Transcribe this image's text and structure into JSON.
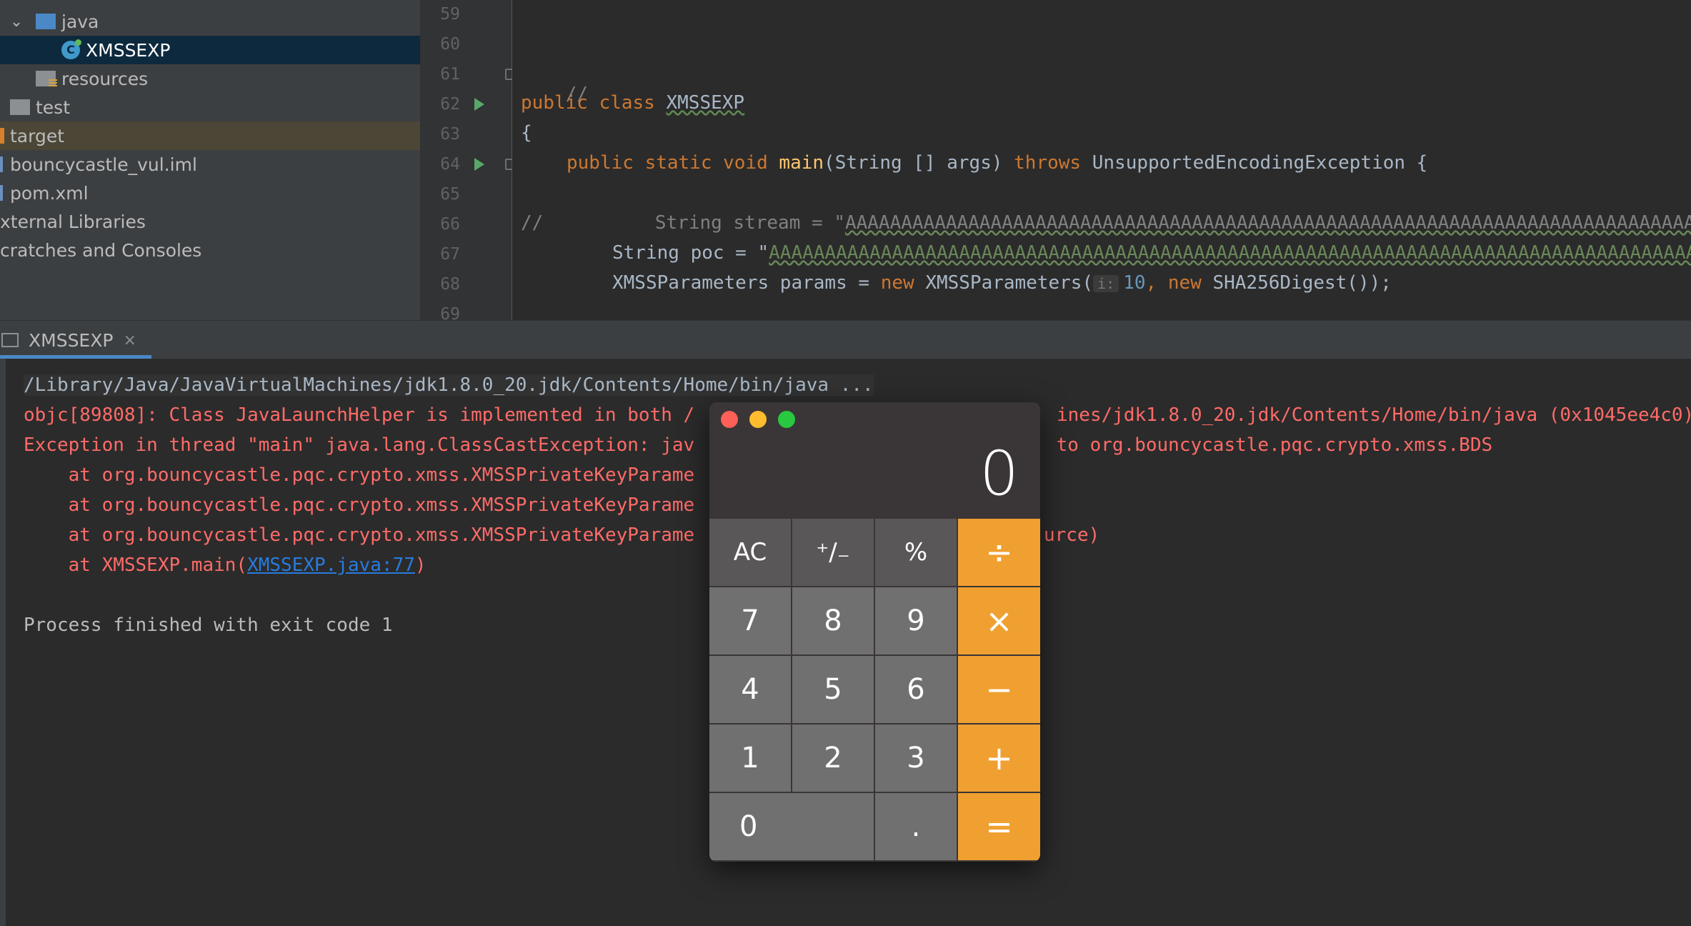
{
  "project_tree": {
    "items": [
      {
        "label": "java",
        "type": "folder-blue",
        "expanded": true
      },
      {
        "label": "XMSSEXP",
        "type": "class",
        "selected": true
      },
      {
        "label": "resources",
        "type": "folder-resources"
      },
      {
        "label": "test",
        "type": "folder-grey"
      },
      {
        "label": "target",
        "type": "folder-excluded"
      },
      {
        "label": "bouncycastle_vul.iml",
        "type": "file"
      },
      {
        "label": "pom.xml",
        "type": "file"
      },
      {
        "label": "xternal Libraries",
        "type": "node"
      },
      {
        "label": "cratches and Consoles",
        "type": "node"
      }
    ]
  },
  "editor": {
    "line_numbers": [
      "59",
      "60",
      "61",
      "62",
      "63",
      "64",
      "65",
      "66",
      "67",
      "68",
      "69"
    ],
    "lines": {
      "l61": "//",
      "l62_kw": "public class ",
      "l62_name": "XMSSEXP",
      "l63": "{",
      "l64_kw": "public static void ",
      "l64_fn": "main",
      "l64_args": "(String [] args) ",
      "l64_throws": "throws ",
      "l64_exc": "UnsupportedEncodingException {",
      "l66_comment": "//",
      "l66_rest": "String stream = \"",
      "l66_str": "AAAAAAAAAAAAAAAAAAAAAAAAAAAAAAAAAAAAAAAAAAAAAAAAAAAAAAAAAAAAAAAAAAAAAAAAAAAAAAAAAAAAAA",
      "l67_rest": "String poc = \"",
      "l67_str": "AAAAAAAAAAAAAAAAAAAAAAAAAAAAAAAAAAAAAAAAAAAAAAAAAAAAAAAAAAAAAAAAAAAAAAAAAAAAAAAAAAAAAAAA",
      "l68_a": "XMSSParameters params = ",
      "l68_new": "new ",
      "l68_b": "XMSSParameters(",
      "l68_hint": "i:",
      "l68_num": "10",
      "l68_c": ", ",
      "l68_new2": "new ",
      "l68_d": "SHA256Digest());"
    }
  },
  "run_panel": {
    "tab_label": "XMSSEXP",
    "close_glyph": "×",
    "console_lines": {
      "cmd": "/Library/Java/JavaVirtualMachines/jdk1.8.0_20.jdk/Contents/Home/bin/java ...",
      "objc_a": "objc[89808]: Class JavaLaunchHelper is implemented in both /",
      "objc_b": "ines/jdk1.8.0_20.jdk/Contents/Home/bin/java (0x1045ee4c0)",
      "exc_a": "Exception in thread \"main\" java.lang.ClassCastException: jav",
      "exc_b": " to org.bouncycastle.pqc.crypto.xmss.BDS",
      "at1": "    at org.bouncycastle.pqc.crypto.xmss.XMSSPrivateKeyParame",
      "at2": "    at org.bouncycastle.pqc.crypto.xmss.XMSSPrivateKeyParame",
      "at3": "    at org.bouncycastle.pqc.crypto.xmss.XMSSPrivateKeyParame",
      "at3_b": "urce)",
      "at4_pre": "    at XMSSEXP.main(",
      "at4_link": "XMSSEXP.java:77",
      "at4_post": ")",
      "finished": "Process finished with exit code 1"
    }
  },
  "calculator": {
    "display": "0",
    "keys": {
      "ac": "AC",
      "sign": "⁺∕₋",
      "percent": "%",
      "divide": "÷",
      "seven": "7",
      "eight": "8",
      "nine": "9",
      "multiply": "×",
      "four": "4",
      "five": "5",
      "six": "6",
      "minus": "−",
      "one": "1",
      "two": "2",
      "three": "3",
      "plus": "+",
      "zero": "0",
      "decimal": ".",
      "equals": "="
    },
    "colors": {
      "operator": "#f0a030",
      "number": "#717071",
      "function": "#5a5758"
    }
  }
}
